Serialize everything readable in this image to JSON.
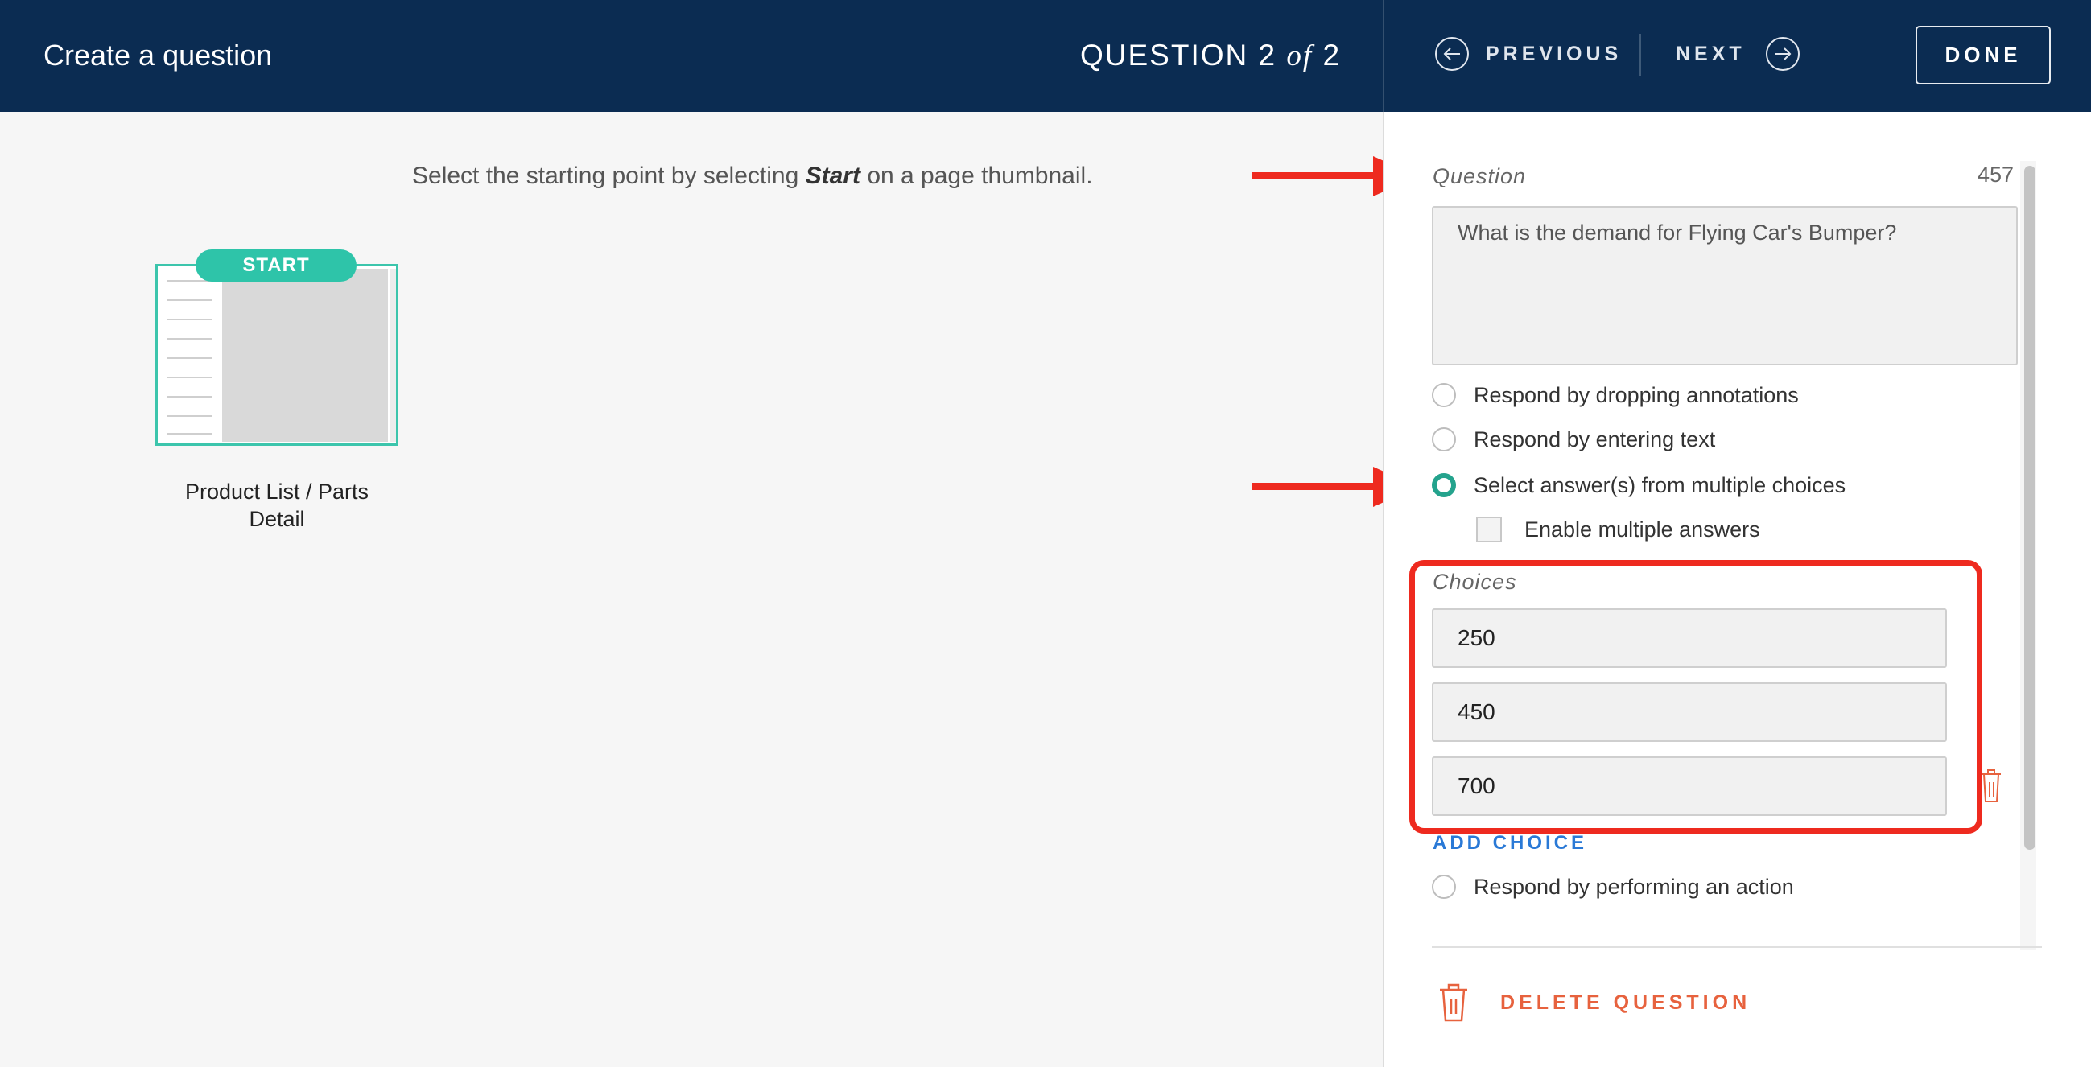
{
  "header": {
    "title": "Create a question",
    "question_prefix": "QUESTION 2 ",
    "question_of": "of",
    "question_total": " 2",
    "previous_label": "PREVIOUS",
    "next_label": "NEXT",
    "done_label": "DONE"
  },
  "canvas": {
    "instruction_before": "Select the starting point by selecting ",
    "instruction_em": "Start",
    "instruction_after": " on a page thumbnail.",
    "start_badge": "START",
    "thumbnail_caption_line1": "Product List / Parts",
    "thumbnail_caption_line2": "Detail"
  },
  "panel": {
    "question_label": "Question",
    "char_count": "457",
    "question_text": "What is the demand for Flying Car's Bumper?",
    "options": [
      {
        "label": "Respond by dropping annotations",
        "selected": false
      },
      {
        "label": "Respond by entering text",
        "selected": false
      },
      {
        "label": "Select answer(s) from multiple choices",
        "selected": true
      },
      {
        "label": "Respond by performing an action",
        "selected": false
      }
    ],
    "enable_multiple_label": "Enable multiple answers",
    "choices_label": "Choices",
    "choices": [
      "250",
      "450",
      "700"
    ],
    "add_choice_label": "ADD CHOICE",
    "delete_question_label": "DELETE QUESTION"
  },
  "colors": {
    "header_bg": "#0b2c52",
    "accent_teal": "#2ec4a9",
    "annotation_red": "#ee2a1f",
    "link_blue": "#2a79d6",
    "delete_orange": "#e7623e"
  },
  "icons": [
    "arrow-left-circle-icon",
    "arrow-right-circle-icon",
    "trash-icon"
  ]
}
